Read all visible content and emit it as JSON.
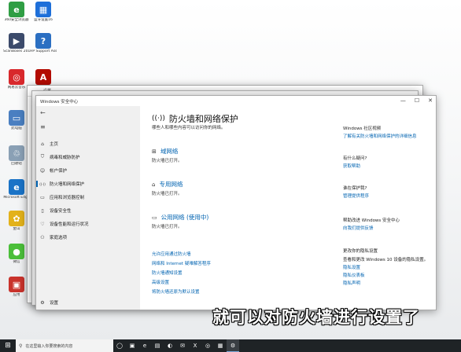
{
  "desktop_icons": [
    {
      "label": "360安全浏览器",
      "color": "#2f9e44",
      "glyph": "e"
    },
    {
      "label": "蓝牙设置16",
      "color": "#1e6fd9",
      "glyph": "▦"
    },
    {
      "label": "ScanBoxes 2019-11-2...",
      "color": "#3b4a6b",
      "glyph": "▶"
    },
    {
      "label": "HP Support Assistant",
      "color": "#2b6fc2",
      "glyph": "?"
    },
    {
      "label": "网易云音乐",
      "color": "#d8282c",
      "glyph": "◎"
    },
    {
      "label": "Acrobat Reader",
      "color": "#b30b00",
      "glyph": "A"
    },
    {
      "label": "此电脑",
      "color": "#4a7fc1",
      "glyph": "▭"
    },
    {
      "label": "回收站",
      "color": "#8aa0b5",
      "glyph": "♲"
    },
    {
      "label": "Microsoft Edge",
      "color": "#1a73c7",
      "glyph": "e"
    },
    {
      "label": "金山",
      "color": "#e3b21b",
      "glyph": "✿"
    },
    {
      "label": "微信",
      "color": "#4bbf3a",
      "glyph": "●"
    },
    {
      "label": "应用",
      "color": "#c9332c",
      "glyph": "▣"
    }
  ],
  "back_window": {
    "title": "设置"
  },
  "window": {
    "title": "Windows 安全中心",
    "controls": {
      "minimize": "—",
      "maximize": "☐",
      "close": "✕"
    }
  },
  "sidebar": {
    "back_glyph": "←",
    "menu_glyph": "≡",
    "items": [
      {
        "label": "主页",
        "icon": "⌂"
      },
      {
        "label": "病毒和威胁防护",
        "icon": "⛉"
      },
      {
        "label": "帐户保护",
        "icon": "☺"
      },
      {
        "label": "防火墙和网络保护",
        "icon": "((·))"
      },
      {
        "label": "应用和浏览器控制",
        "icon": "▭"
      },
      {
        "label": "设备安全性",
        "icon": "▯"
      },
      {
        "label": "设备性能和运行状况",
        "icon": "♡"
      },
      {
        "label": "家庭选项",
        "icon": "⚇"
      }
    ],
    "settings": {
      "label": "设置",
      "icon": "⚙"
    }
  },
  "main": {
    "title": "防火墙和网络保护",
    "subtitle": "哪些人和哪些内容可以访问你的网络。",
    "networks": [
      {
        "name": "域网络",
        "status": "防火墙已打开。",
        "icon": "⊞"
      },
      {
        "name": "专用网络",
        "status": "防火墙已打开。",
        "icon": "⌂"
      },
      {
        "name": "公用网络  (使用中)",
        "status": "防火墙已打开。",
        "icon": "▭"
      }
    ],
    "links": [
      "允许应用通过防火墙",
      "网络和 Internet 疑难解答程序",
      "防火墙通知设置",
      "高级设置",
      "将防火墙还原为默认设置"
    ]
  },
  "right": {
    "sections": [
      {
        "heading": "Windows 社区视频",
        "link": "了解有关防火墙和网络保护的详细信息"
      },
      {
        "heading": "有什么疑问?",
        "link": "获取帮助"
      },
      {
        "heading": "谁在保护我?",
        "link": "管理提供程序"
      },
      {
        "heading": "帮助改进 Windows 安全中心",
        "link": "向我们提供反馈"
      },
      {
        "heading": "更改你的隐私设置",
        "text": "查看和更改 Windows 10 设备的隐私设置。",
        "links": [
          "隐私设置",
          "隐私仪表板",
          "隐私声明"
        ]
      }
    ]
  },
  "caption": "就可以对防火墙进行设置了",
  "taskbar": {
    "start_glyph": "⊞",
    "search_placeholder": "在这里输入你要搜索的内容",
    "search_icon": "⚲",
    "icons": [
      "◯",
      "▣",
      "e",
      "▤",
      "◐",
      "✉",
      "X",
      "◎",
      "▦",
      "⚙"
    ]
  }
}
